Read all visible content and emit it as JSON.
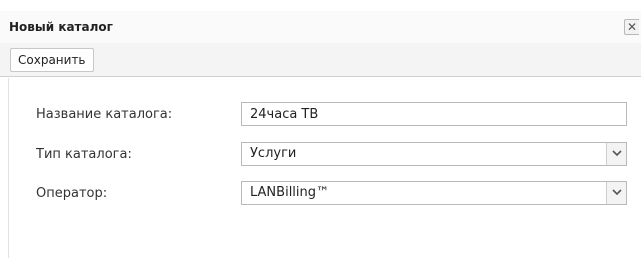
{
  "window": {
    "title": "Новый каталог",
    "close_glyph": "✕"
  },
  "toolbar": {
    "save_label": "Сохранить"
  },
  "form": {
    "name_label": "Название каталога:",
    "name_value": "24часа ТВ",
    "type_label": "Тип каталога:",
    "type_value": "Услуги",
    "operator_label": "Оператор:",
    "operator_value": "LANBilling™"
  },
  "icons": {
    "close": "close-icon",
    "dropdown": "chevron-down-icon"
  },
  "colors": {
    "toolbar_bg": "#f4f4f4",
    "field_border": "#b9b9b9"
  }
}
